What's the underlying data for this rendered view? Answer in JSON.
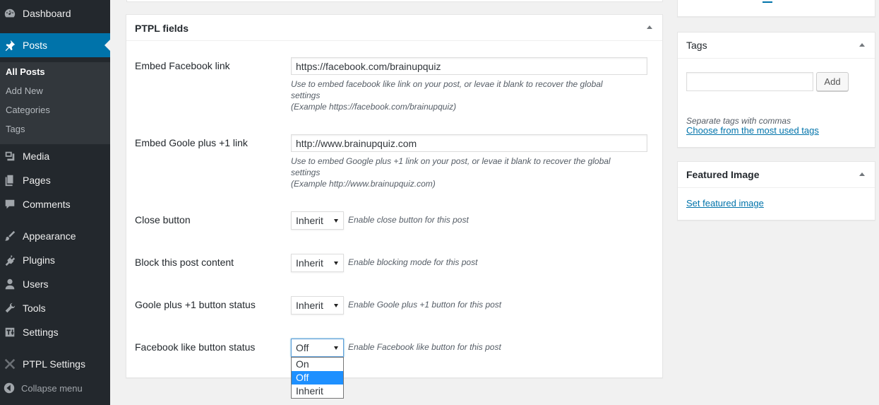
{
  "sidebar": {
    "items": [
      {
        "label": "Dashboard",
        "icon": "dashboard-icon"
      },
      {
        "label": "Posts",
        "icon": "pin-icon",
        "active": true
      },
      {
        "label": "Media",
        "icon": "media-icon"
      },
      {
        "label": "Pages",
        "icon": "pages-icon"
      },
      {
        "label": "Comments",
        "icon": "comment-icon"
      },
      {
        "label": "Appearance",
        "icon": "brush-icon"
      },
      {
        "label": "Plugins",
        "icon": "plugin-icon"
      },
      {
        "label": "Users",
        "icon": "user-icon"
      },
      {
        "label": "Tools",
        "icon": "wrench-icon"
      },
      {
        "label": "Settings",
        "icon": "settings-icon"
      },
      {
        "label": "PTPL Settings",
        "icon": "x-icon"
      }
    ],
    "submenu": [
      "All Posts",
      "Add New",
      "Categories",
      "Tags"
    ],
    "collapse_label": "Collapse menu"
  },
  "ptpl": {
    "title": "PTPL fields",
    "facebook_link": {
      "label": "Embed Facebook link",
      "value": "https://facebook.com/brainupquiz",
      "help_line1": "Use to embed facebook like link on your post, or levae it blank to recover the global",
      "help_line2": "settings",
      "help_line3": "(Example https://facebook.com/brainupquiz)"
    },
    "google_link": {
      "label": "Embed Goole plus +1 link",
      "value": "http://www.brainupquiz.com",
      "help_line1": "Use to embed Google plus +1 link on your post, or levae it blank to recover the global",
      "help_line2": "settings",
      "help_line3": "(Example http://www.brainupquiz.com)"
    },
    "close_button": {
      "label": "Close button",
      "value": "Inherit",
      "desc": "Enable close button for this post"
    },
    "block_content": {
      "label": "Block this post content",
      "value": "Inherit",
      "desc": "Enable blocking mode for this post"
    },
    "google_status": {
      "label": "Goole plus +1 button status",
      "value": "Inherit",
      "desc": "Enable Goole plus +1 button for this post"
    },
    "facebook_status": {
      "label": "Facebook like button status",
      "value": "Off",
      "desc": "Enable Facebook like button for this post",
      "options": [
        "On",
        "Off",
        "Inherit"
      ],
      "highlighted": "Off"
    }
  },
  "tags_box": {
    "title": "Tags",
    "add_label": "Add",
    "note": "Separate tags with commas",
    "choose_link": "Choose from the most used tags"
  },
  "featured_box": {
    "title": "Featured Image",
    "set_link": "Set featured image"
  },
  "colors": {
    "sidebar_bg": "#23282d",
    "active_blue": "#0073aa",
    "link_blue": "#0073aa",
    "dropdown_highlight": "#1e90ff"
  }
}
